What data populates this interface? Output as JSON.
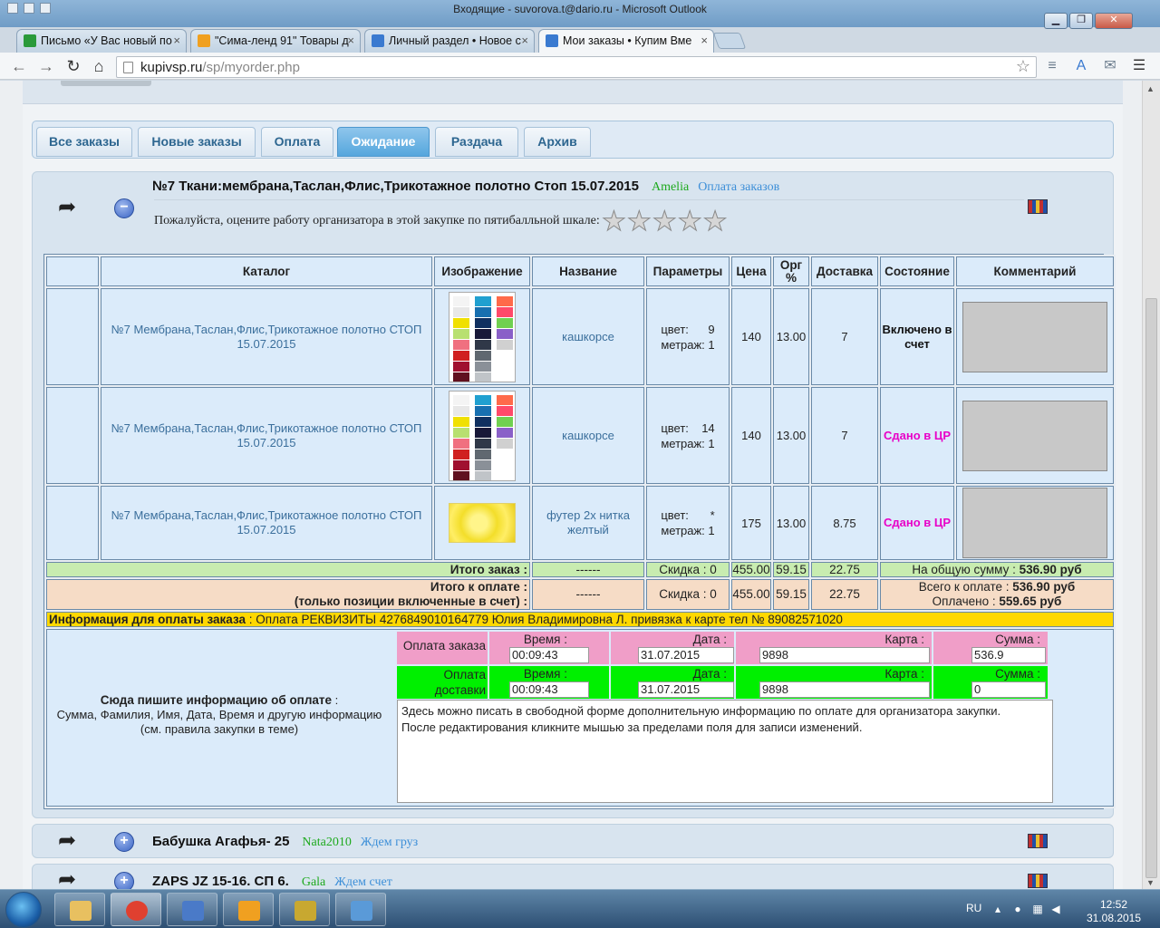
{
  "window": {
    "title": "Входящие - suvorova.t@dario.ru - Microsoft Outlook"
  },
  "browser": {
    "tabs": [
      {
        "label": "Письмо «У Вас новый по",
        "icon_color": "#2a9a3a"
      },
      {
        "label": "\"Сима-ленд 91\" Товары д",
        "icon_color": "#f0a020"
      },
      {
        "label": "Личный раздел • Новое с",
        "icon_color": "#3a7ad0"
      },
      {
        "label": "Мои заказы • Купим Вме",
        "icon_color": "#3a7ad0"
      }
    ],
    "close_glyph": "×",
    "url_host": "kupivsp.ru",
    "url_path": "/sp/myorder.php"
  },
  "order_tabs": [
    "Все заказы",
    "Новые заказы",
    "Оплата",
    "Ожидание",
    "Раздача",
    "Архив"
  ],
  "active_tab_index": 3,
  "main_order": {
    "title": "№7 Ткани:мембрана,Таслан,Флис,Трикотажное полотно Стоп 15.07.2015",
    "organizer": "Amelia",
    "status_link": "Оплата заказов",
    "rating_prompt": "Пожалуйста, оцените работу организатора в этой закупке по пятибалльной шкале:",
    "rating_value": 0,
    "rating_max": 5,
    "columns": [
      "Каталог",
      "Изображение",
      "Название",
      "Параметры",
      "Цена",
      "Орг %",
      "Доставка",
      "Состояние",
      "Комментарий"
    ],
    "rows": [
      {
        "catalog": "№7 Мембрана,Таслан,Флис,Трикотажное полотно СТОП 15.07.2015",
        "name": "кашкорсе",
        "color_label": "цвет:",
        "color_value": "9",
        "meter_label": "метраж:",
        "meter_value": "1",
        "price": "140",
        "org": "13.00",
        "delivery": "7",
        "state": "Включено в счет",
        "state_color": "#111111"
      },
      {
        "catalog": "№7 Мембрана,Таслан,Флис,Трикотажное полотно СТОП 15.07.2015",
        "name": "кашкорсе",
        "color_label": "цвет:",
        "color_value": "14",
        "meter_label": "метраж:",
        "meter_value": "1",
        "price": "140",
        "org": "13.00",
        "delivery": "7",
        "state": "Сдано в ЦР",
        "state_color": "#e800c8"
      },
      {
        "catalog": "№7 Мембрана,Таслан,Флис,Трикотажное полотно СТОП 15.07.2015",
        "name": "футер 2х нитка желтый",
        "color_label": "цвет:",
        "color_value": "*",
        "meter_label": "метраж:",
        "meter_value": "1",
        "price": "175",
        "org": "13.00",
        "delivery": "8.75",
        "state": "Сдано в ЦР",
        "state_color": "#e800c8"
      }
    ],
    "total": {
      "label": "Итого заказ :",
      "dash": "------",
      "discount": "Скидка : 0",
      "price": "455.00",
      "org": "59.15",
      "delivery": "22.75",
      "sum_label": "На общую сумму :",
      "sum_value": "536.90 руб"
    },
    "pay_total": {
      "label_line1": "Итого к оплате :",
      "label_line2": "(только позиции включенные в счет) :",
      "dash": "------",
      "discount": "Скидка : 0",
      "price": "455.00",
      "org": "59.15",
      "delivery": "22.75",
      "due_label": "Всего к оплате :",
      "due_value": "536.90 руб",
      "paid_label": "Оплачено :",
      "paid_value": "559.65 руб"
    },
    "payment_info": {
      "label": "Информация для оплаты заказа",
      "text": " : Оплата РЕКВИЗИТЫ 4276849010164779 Юлия Владимировна Л. привязка к карте тел № 89082571020"
    },
    "pay_hint": {
      "bold": "Сюда пишите информацию об оплате",
      "colon": " :",
      "line2": "Сумма, Фамилия, Имя, Дата, Время и другую информацию",
      "line3": "(см. правила закупки в теме)"
    },
    "payment_order": {
      "label": "Оплата заказа",
      "time_label": "Время :",
      "time": "00:09:43",
      "date_label": "Дата :",
      "date": "31.07.2015",
      "card_label": "Карта :",
      "card": "9898",
      "sum_label": "Сумма :",
      "sum": "536.9"
    },
    "payment_delivery": {
      "label": "Оплата доставки",
      "time_label": "Время :",
      "time": "00:09:43",
      "date_label": "Дата :",
      "date": "31.07.2015",
      "card_label": "Карта :",
      "card": "9898",
      "sum_label": "Сумма :",
      "sum": "0"
    },
    "free_text": "Здесь можно писать в свободной форме дополнительную информацию по оплате для организатора закупки.\nПосле редактирования кликните мышью за пределами поля для записи изменений."
  },
  "other_orders": [
    {
      "title": "Бабушка Агафья- 25",
      "organizer": "Nata2010",
      "status": "Ждем груз"
    },
    {
      "title": "ZAPS JZ 15-16. СП 6.",
      "organizer": "Gala",
      "status": "Ждем счет"
    }
  ],
  "expand_glyph": "+",
  "collapse_glyph": "−",
  "taskbar": {
    "lang": "RU",
    "time": "12:52",
    "date": "31.08.2015",
    "apps": [
      {
        "name": "explorer",
        "color": "#e8c060"
      },
      {
        "name": "chrome",
        "color": "#e04030"
      },
      {
        "name": "remote-desktop",
        "color": "#4a7ac8"
      },
      {
        "name": "outlook",
        "color": "#f0a020"
      },
      {
        "name": "app-5",
        "color": "#c8a830"
      },
      {
        "name": "photo-viewer",
        "color": "#5a9ad8"
      }
    ]
  },
  "colors": {
    "accent_tab": "#55a6dd",
    "green_total": "#c8ecb0",
    "pay_row": "#f6dcc6",
    "info_yellow": "#ffd800",
    "state_pink": "#e800c8",
    "payment_pink": "#f09ec8",
    "payment_green": "#00f000"
  }
}
